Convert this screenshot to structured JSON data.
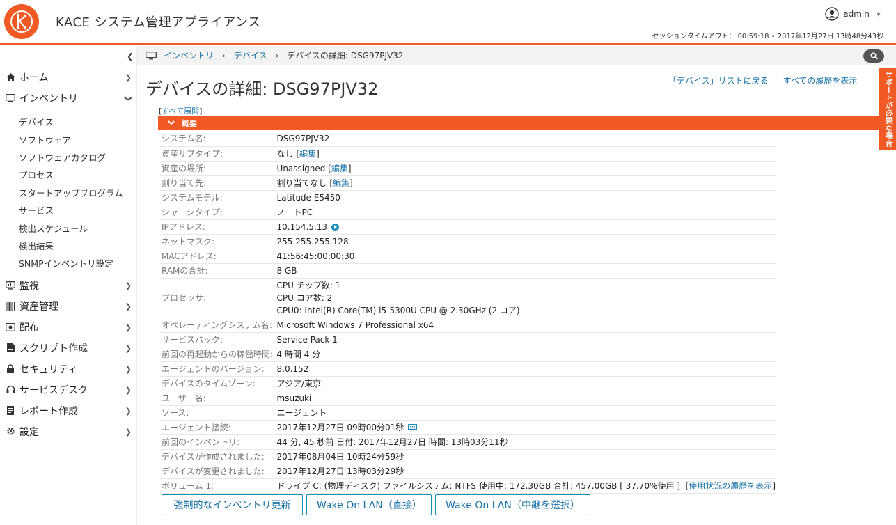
{
  "header": {
    "title": "KACE システム管理アプライアンス",
    "user": "admin",
    "session": "セッションタイムアウト： 00:59:18 • 2017年12月27日 13時48分43秒"
  },
  "sidebar": {
    "items": [
      {
        "label": "ホーム",
        "icon": "home-icon"
      },
      {
        "label": "インベントリ",
        "icon": "monitor-icon"
      },
      {
        "label": "監視",
        "icon": "monitoring-icon"
      },
      {
        "label": "資産管理",
        "icon": "barcode-icon"
      },
      {
        "label": "配布",
        "icon": "distribution-icon"
      },
      {
        "label": "スクリプト作成",
        "icon": "script-icon"
      },
      {
        "label": "セキュリティ",
        "icon": "lock-icon"
      },
      {
        "label": "サービスデスク",
        "icon": "headset-icon"
      },
      {
        "label": "レポート作成",
        "icon": "report-icon"
      },
      {
        "label": "設定",
        "icon": "gear-icon"
      }
    ],
    "inventory_sub": [
      "デバイス",
      "ソフトウェア",
      "ソフトウェアカタログ",
      "プロセス",
      "スタートアッププログラム",
      "サービス",
      "検出スケジュール",
      "検出結果",
      "SNMPインベントリ設定"
    ]
  },
  "breadcrumb": {
    "inventory": "インベントリ",
    "devices": "デバイス",
    "current": "デバイスの詳細: DSG97PJV32"
  },
  "support_tab": "サポートが必要な場合",
  "page": {
    "title": "デバイスの詳細: DSG97PJV32",
    "back_link": "「デバイス」リストに戻る",
    "history_link": "すべての履歴を表示",
    "expand_all": "すべて展開",
    "section": "概要",
    "edit": "編集"
  },
  "details": [
    {
      "k": "システム名:",
      "v": "DSG97PJV32"
    },
    {
      "k": "資産サブタイプ:",
      "v": "なし"
    },
    {
      "k": "資産の場所:",
      "v": "Unassigned"
    },
    {
      "k": "割り当て先:",
      "v": "割り当てなし"
    },
    {
      "k": "システムモデル:",
      "v": "Latitude E5450"
    },
    {
      "k": "シャーシタイプ:",
      "v": "ノートPC"
    },
    {
      "k": "IPアドレス:",
      "v": "10.154.5.13"
    },
    {
      "k": "ネットマスク:",
      "v": "255.255.255.128"
    },
    {
      "k": "MACアドレス:",
      "v": "41:56:45:00:00:30"
    },
    {
      "k": "RAMの合計:",
      "v": "8 GB"
    },
    {
      "k": "プロセッサ:",
      "v1": "CPU チップ数: 1",
      "v2": "CPU コア数: 2",
      "v3": "CPU0: Intel(R) Core(TM) i5-5300U CPU @ 2.30GHz (2 コア)"
    },
    {
      "k": "オペレーティングシステム名:",
      "v": "Microsoft Windows 7 Professional x64"
    },
    {
      "k": "サービスパック:",
      "v": "Service Pack 1"
    },
    {
      "k": "前回の再起動からの稼働時間:",
      "v": "4 時間 4 分"
    },
    {
      "k": "エージェントのバージョン:",
      "v": "8.0.152"
    },
    {
      "k": "デバイスのタイムゾーン:",
      "v": "アジア/東京"
    },
    {
      "k": "ユーザー名:",
      "v": "msuzuki"
    },
    {
      "k": "ソース:",
      "v": "エージェント"
    },
    {
      "k": "エージェント接続:",
      "v": "2017年12月27日 09時00分01秒"
    },
    {
      "k": "前回のインベントリ:",
      "v": "44 分, 45 秒前 日付: 2017年12月27日 時間: 13時03分11秒"
    },
    {
      "k": "デバイスが作成されました:",
      "v": "2017年08月04日 10時24分59秒"
    },
    {
      "k": "デバイスが変更されました:",
      "v": "2017年12月27日 13時03分29秒"
    },
    {
      "k": "ボリューム 1:",
      "v": "ドライブ C: (物理ディスク) ファイルシステム: NTFS 使用中: 172.30GB 合計: 457.00GB [ 37.70%使用 ]",
      "link": "使用状況の履歴を表示"
    }
  ],
  "buttons": {
    "force_inventory": "強制的なインベントリ更新",
    "wol_direct": "Wake On LAN（直接）",
    "wol_relay": "Wake On LAN（中継を選択）"
  }
}
